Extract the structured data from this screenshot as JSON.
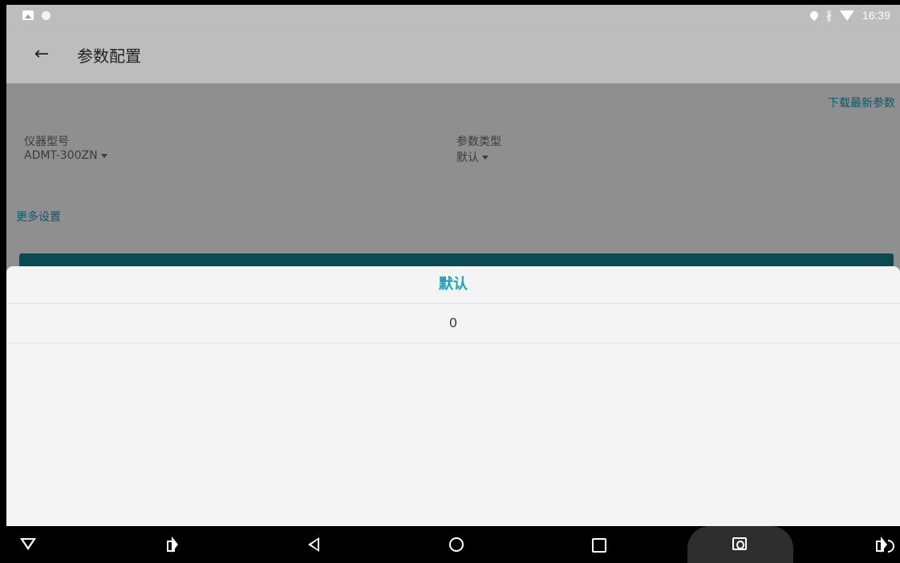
{
  "status_bar": {
    "time": "16:39",
    "icons": [
      "image-icon",
      "dot-icon",
      "location-icon",
      "bluetooth-icon",
      "wifi-icon"
    ]
  },
  "app_bar": {
    "title": "参数配置",
    "back_icon": "arrow-left-icon"
  },
  "content": {
    "download_link": "下载最新参数",
    "instrument_model": {
      "label": "仪器型号",
      "value": "ADMT-300ZN"
    },
    "param_type": {
      "label": "参数类型",
      "value": "默认"
    },
    "more_settings": "更多设置"
  },
  "sheet": {
    "title": "默认",
    "options": [
      "0"
    ]
  },
  "nav_bar": {
    "icons": [
      "hide-keyboard-icon",
      "volume-down-icon",
      "back-icon",
      "home-icon",
      "recents-icon",
      "screenshot-icon",
      "volume-up-icon"
    ]
  },
  "colors": {
    "accent": "#1ba0c0",
    "link": "#0a5a66",
    "scrim": "#8f8f8f",
    "sheet_bg": "#f4f4f4"
  }
}
